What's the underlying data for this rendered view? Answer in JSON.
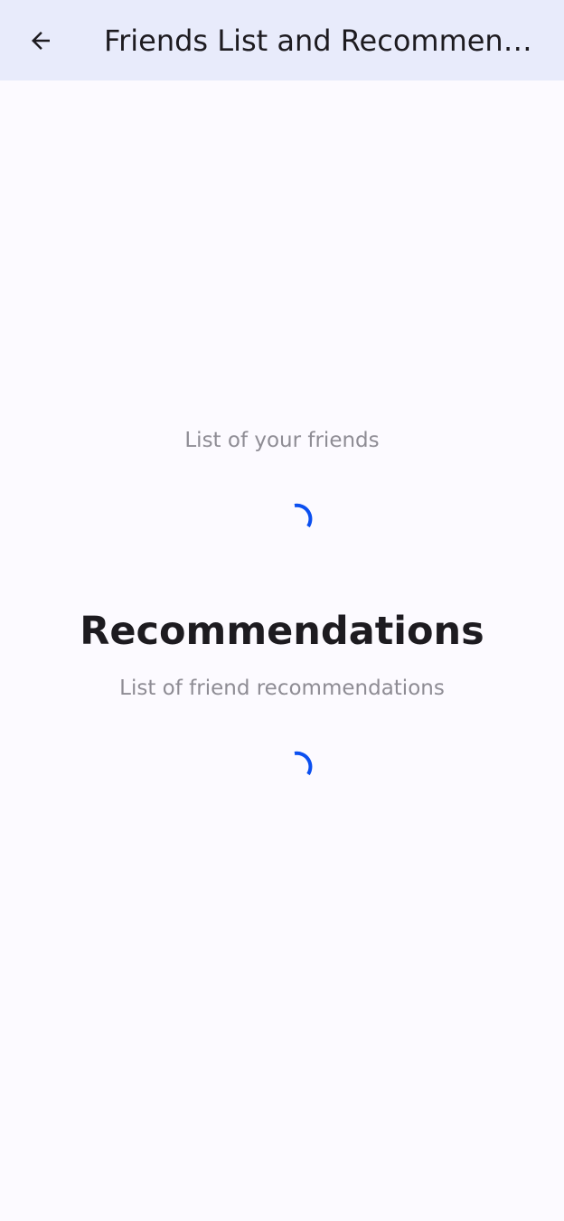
{
  "app_bar": {
    "title": "Friends List and Recommendations",
    "back_icon": "arrow-back-icon",
    "background": "#e8ebfb"
  },
  "friends_section": {
    "subtitle": "List of your friends",
    "loading": true
  },
  "recommendations_section": {
    "title": "Recommendations",
    "subtitle": "List of friend recommendations",
    "loading": true
  },
  "colors": {
    "spinner": "#0b4ff0",
    "page_background": "#fcfaff"
  }
}
